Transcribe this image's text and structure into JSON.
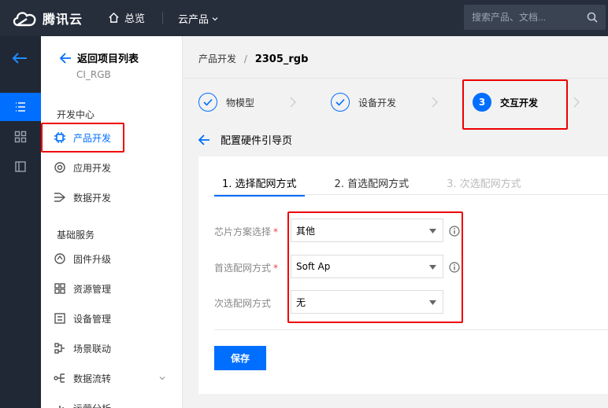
{
  "header": {
    "brand": "腾讯云",
    "home_label": "总览",
    "products_label": "云产品",
    "search_placeholder": "搜索产品、文档..."
  },
  "sidebar": {
    "back_label": "返回项目列表",
    "project_name": "CI_RGB",
    "section1": "开发中心",
    "section2": "基础服务",
    "items": [
      {
        "label": "产品开发"
      },
      {
        "label": "应用开发"
      },
      {
        "label": "数据开发"
      },
      {
        "label": "固件升级"
      },
      {
        "label": "资源管理"
      },
      {
        "label": "设备管理"
      },
      {
        "label": "场景联动"
      },
      {
        "label": "数据流转"
      },
      {
        "label": "运营分析"
      }
    ]
  },
  "breadcrumb": {
    "parent": "产品开发",
    "separator": "/",
    "current": "2305_rgb"
  },
  "steps": [
    {
      "label": "物模型",
      "state": "done"
    },
    {
      "label": "设备开发",
      "state": "done"
    },
    {
      "number": "3",
      "label": "交互开发",
      "state": "current"
    }
  ],
  "page_title": "配置硬件引导页",
  "tabs": [
    {
      "label": "1. 选择配网方式"
    },
    {
      "label": "2. 首选配网方式"
    },
    {
      "label": "3. 次选配网方式"
    }
  ],
  "form": {
    "chip_label": "芯片方案选择",
    "chip_value": "其他",
    "primary_label": "首选配网方式",
    "primary_value": "Soft Ap",
    "secondary_label": "次选配网方式",
    "secondary_value": "无",
    "required_mark": "*"
  },
  "save_label": "保存",
  "colors": {
    "accent": "#006eff",
    "topbar": "#262e3b",
    "highlight": "#ee0000"
  }
}
